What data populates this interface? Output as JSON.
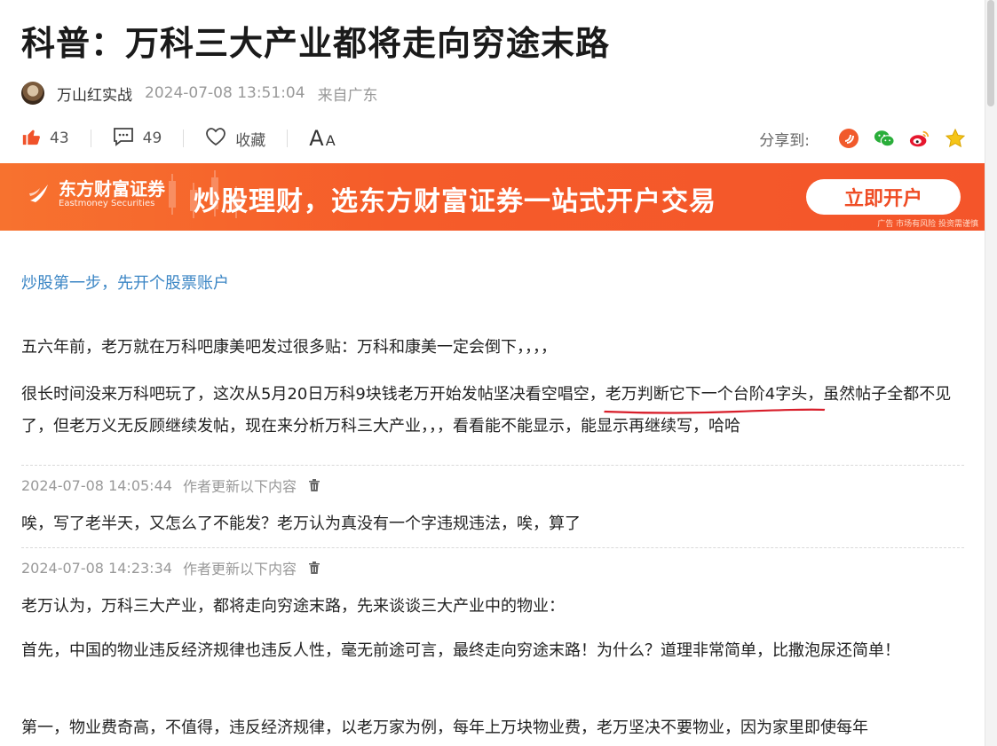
{
  "article": {
    "title": "科普：万科三大产业都将走向穷途末路",
    "author": "万山红实战",
    "time": "2024-07-08 13:51:04",
    "from": "来自广东"
  },
  "actions": {
    "likes": "43",
    "comments": "49",
    "favorite_label": "收藏",
    "font_big": "A",
    "font_small": "A",
    "share_label": "分享到:"
  },
  "banner": {
    "brand_cn": "东方财富证券",
    "brand_en": "Eastmoney Securities",
    "slogan": "炒股理财，选东方财富证券一站式开户交易",
    "cta": "立即开户",
    "note": "广告 市场有风险 投资需谨慎"
  },
  "promo_link": "炒股第一步，先开个股票账户",
  "paragraphs": {
    "p1": "五六年前，老万就在万科吧康美吧发过很多贴：万科和康美一定会倒下，，，，",
    "p2_before": "很长时间没来万科吧玩了，这次从5月20日万科9块钱老万开始发帖坚决看空唱空，",
    "p2_highlight": "老万判断它下一个台阶4字头，",
    "p2_after": "虽然帖子全都不见了，但老万义无反顾继续发帖，现在来分析万科三大产业，，，看看能不能显示，能显示再继续写，哈哈",
    "p3": "唉，写了老半天，又怎么了不能发？老万认为真没有一个字违规违法，唉，算了",
    "p4": "老万认为，万科三大产业，都将走向穷途末路，先来谈谈三大产业中的物业：",
    "p5": "首先，中国的物业违反经济规律也违反人性，毫无前途可言，最终走向穷途末路！为什么？道理非常简单，比撒泡尿还简单！",
    "p6": "第一，物业费奇高，不值得，违反经济规律，以老万家为例，每年上万块物业费，老万坚决不要物业，因为家里即使每年"
  },
  "updates": [
    {
      "time": "2024-07-08 14:05:44",
      "label": "作者更新以下内容"
    },
    {
      "time": "2024-07-08 14:23:34",
      "label": "作者更新以下内容"
    }
  ],
  "colors": {
    "banner": "#f55c2a",
    "link": "#3b86c5",
    "like": "#f0522a",
    "underline": "#d81e2a"
  },
  "icons": [
    "like-icon",
    "comment-icon",
    "heart-icon",
    "share-douyin-icon",
    "wechat-icon",
    "weibo-icon",
    "star-icon",
    "trash-icon"
  ]
}
